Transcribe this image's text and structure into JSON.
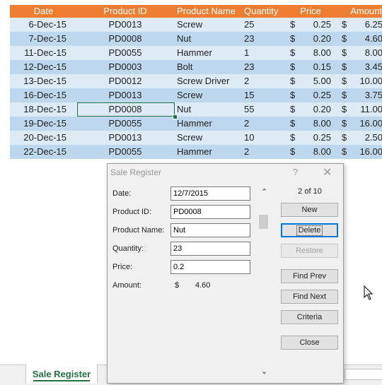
{
  "table": {
    "headers": [
      "Date",
      "Product ID",
      "Product Name",
      "Quantity",
      "Price",
      "Amount"
    ],
    "rows": [
      {
        "date": "6-Dec-15",
        "pid": "PD0013",
        "name": "Screw",
        "qty": "25",
        "price": "0.25",
        "amount": "6.25"
      },
      {
        "date": "7-Dec-15",
        "pid": "PD0008",
        "name": "Nut",
        "qty": "23",
        "price": "0.20",
        "amount": "4.60"
      },
      {
        "date": "11-Dec-15",
        "pid": "PD0055",
        "name": "Hammer",
        "qty": "1",
        "price": "8.00",
        "amount": "8.00"
      },
      {
        "date": "12-Dec-15",
        "pid": "PD0003",
        "name": "Bolt",
        "qty": "23",
        "price": "0.15",
        "amount": "3.45"
      },
      {
        "date": "13-Dec-15",
        "pid": "PD0012",
        "name": "Screw Driver",
        "qty": "2",
        "price": "5.00",
        "amount": "10.00"
      },
      {
        "date": "16-Dec-15",
        "pid": "PD0013",
        "name": "Screw",
        "qty": "15",
        "price": "0.25",
        "amount": "3.75"
      },
      {
        "date": "18-Dec-15",
        "pid": "PD0008",
        "name": "Nut",
        "qty": "55",
        "price": "0.20",
        "amount": "11.00"
      },
      {
        "date": "19-Dec-15",
        "pid": "PD0055",
        "name": "Hammer",
        "qty": "2",
        "price": "8.00",
        "amount": "16.00"
      },
      {
        "date": "20-Dec-15",
        "pid": "PD0013",
        "name": "Screw",
        "qty": "10",
        "price": "0.25",
        "amount": "2.50"
      },
      {
        "date": "22-Dec-15",
        "pid": "PD0055",
        "name": "Hammer",
        "qty": "2",
        "price": "8.00",
        "amount": "16.00"
      }
    ],
    "currency": "$"
  },
  "sheet_tab": "Sale Register",
  "dialog": {
    "title": "Sale Register",
    "help": "?",
    "close": "✕",
    "record_count": "2 of 10",
    "fields": {
      "date_label": "Date:",
      "date_value": "12/7/2015",
      "product_id_label": "Product ID:",
      "product_id_value": "PD0008",
      "product_name_label": "Product Name:",
      "product_name_value": "Nut",
      "quantity_label": "Quantity:",
      "quantity_value": "23",
      "price_label": "Price:",
      "price_value": "0.2",
      "amount_label": "Amount:",
      "amount_currency": "$",
      "amount_value": "4.60"
    },
    "buttons": {
      "new": "New",
      "delete": "Delete",
      "restore": "Restore",
      "find_prev": "Find Prev",
      "find_next": "Find Next",
      "criteria": "Criteria",
      "close": "Close"
    }
  },
  "colors": {
    "header_bg": "#ed7d31",
    "row_light": "#ddebf7",
    "row_dark": "#bdd7ee",
    "excel_green": "#217346"
  },
  "icons": [
    "scroll-up-icon",
    "scroll-down-icon",
    "mouse-pointer-icon",
    "close-icon",
    "help-icon"
  ]
}
